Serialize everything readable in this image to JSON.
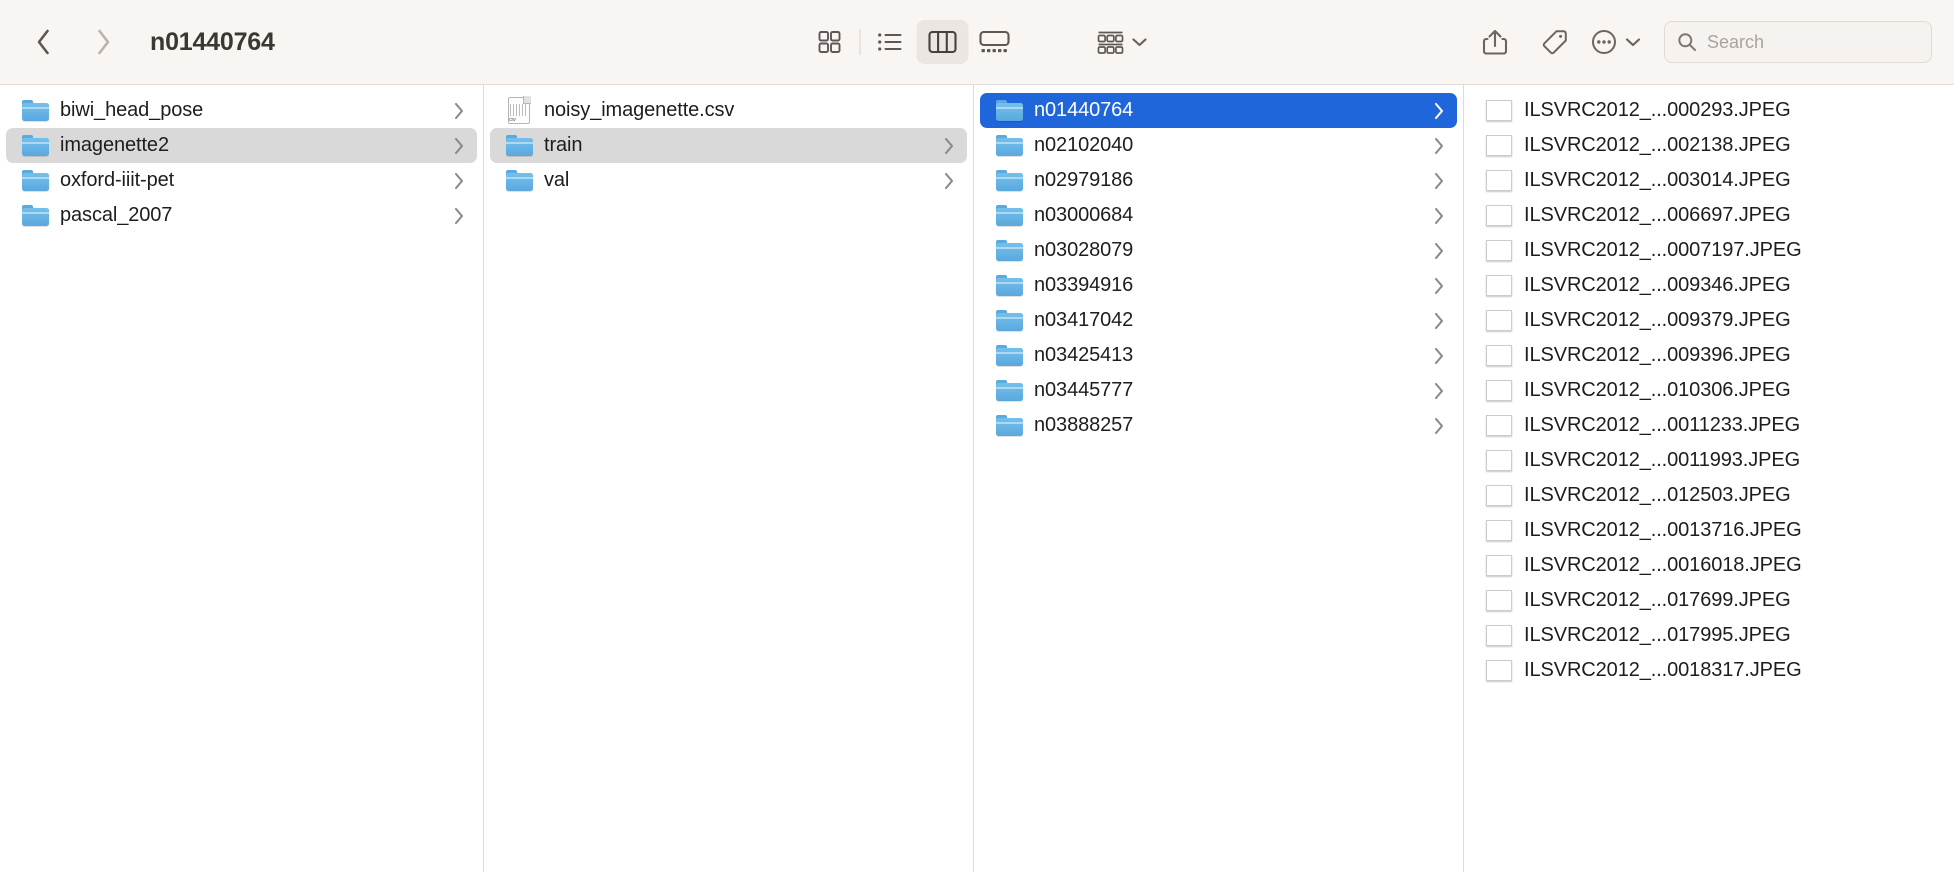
{
  "window": {
    "title": "n01440764"
  },
  "toolbar": {
    "back_label": "Back",
    "forward_label": "Forward",
    "view_icon_label": "Icon view",
    "view_list_label": "List view",
    "view_column_label": "Column view",
    "view_gallery_label": "Gallery view",
    "group_label": "Group items",
    "share_label": "Share",
    "tag_label": "Tags",
    "more_label": "More",
    "active_view": "column",
    "accent_color": "#1f66da",
    "toolbar_bg": "#f9f5f2"
  },
  "search": {
    "value": "",
    "placeholder": "Search"
  },
  "columns": [
    {
      "name": "column-1",
      "items": [
        {
          "label": "biwi_head_pose",
          "type": "folder",
          "selected": false,
          "disclosure": true
        },
        {
          "label": "imagenette2",
          "type": "folder",
          "selected": "gray",
          "disclosure": true
        },
        {
          "label": "oxford-iiit-pet",
          "type": "folder",
          "selected": false,
          "disclosure": true
        },
        {
          "label": "pascal_2007",
          "type": "folder",
          "selected": false,
          "disclosure": true
        }
      ]
    },
    {
      "name": "column-2",
      "items": [
        {
          "label": "noisy_imagenette.csv",
          "type": "csv",
          "selected": false,
          "disclosure": false
        },
        {
          "label": "train",
          "type": "folder",
          "selected": "gray",
          "disclosure": true
        },
        {
          "label": "val",
          "type": "folder",
          "selected": false,
          "disclosure": true
        }
      ]
    },
    {
      "name": "column-3",
      "items": [
        {
          "label": "n01440764",
          "type": "folder",
          "selected": "blue",
          "disclosure": true
        },
        {
          "label": "n02102040",
          "type": "folder",
          "selected": false,
          "disclosure": true
        },
        {
          "label": "n02979186",
          "type": "folder",
          "selected": false,
          "disclosure": true
        },
        {
          "label": "n03000684",
          "type": "folder",
          "selected": false,
          "disclosure": true
        },
        {
          "label": "n03028079",
          "type": "folder",
          "selected": false,
          "disclosure": true
        },
        {
          "label": "n03394916",
          "type": "folder",
          "selected": false,
          "disclosure": true
        },
        {
          "label": "n03417042",
          "type": "folder",
          "selected": false,
          "disclosure": true
        },
        {
          "label": "n03425413",
          "type": "folder",
          "selected": false,
          "disclosure": true
        },
        {
          "label": "n03445777",
          "type": "folder",
          "selected": false,
          "disclosure": true
        },
        {
          "label": "n03888257",
          "type": "folder",
          "selected": false,
          "disclosure": true
        }
      ]
    },
    {
      "name": "column-4",
      "items": [
        {
          "label": "ILSVRC2012_...000293.JPEG",
          "type": "image",
          "selected": false,
          "disclosure": false,
          "thumb": "#7d8a5c"
        },
        {
          "label": "ILSVRC2012_...002138.JPEG",
          "type": "image",
          "selected": false,
          "disclosure": false,
          "thumb": "#3c4a36"
        },
        {
          "label": "ILSVRC2012_...003014.JPEG",
          "type": "image",
          "selected": false,
          "disclosure": false,
          "thumb": "#8a4630"
        },
        {
          "label": "ILSVRC2012_...006697.JPEG",
          "type": "image",
          "selected": false,
          "disclosure": false,
          "thumb": "#59703f"
        },
        {
          "label": "ILSVRC2012_...0007197.JPEG",
          "type": "image",
          "selected": false,
          "disclosure": false,
          "thumb": "#6d7b39"
        },
        {
          "label": "ILSVRC2012_...009346.JPEG",
          "type": "image",
          "selected": false,
          "disclosure": false,
          "thumb": "#4a5340"
        },
        {
          "label": "ILSVRC2012_...009379.JPEG",
          "type": "image",
          "selected": false,
          "disclosure": false,
          "thumb": "#6b7b55"
        },
        {
          "label": "ILSVRC2012_...009396.JPEG",
          "type": "image",
          "selected": false,
          "disclosure": false,
          "thumb": "#9aa487"
        },
        {
          "label": "ILSVRC2012_...010306.JPEG",
          "type": "image",
          "selected": false,
          "disclosure": false,
          "thumb": "#8e8275"
        },
        {
          "label": "ILSVRC2012_...0011233.JPEG",
          "type": "image",
          "selected": false,
          "disclosure": false,
          "thumb": "#4f6040"
        },
        {
          "label": "ILSVRC2012_...0011993.JPEG",
          "type": "image",
          "selected": false,
          "disclosure": false,
          "thumb": "#7f8a5e"
        },
        {
          "label": "ILSVRC2012_...012503.JPEG",
          "type": "image",
          "selected": false,
          "disclosure": false,
          "thumb": "#566246"
        },
        {
          "label": "ILSVRC2012_...0013716.JPEG",
          "type": "image",
          "selected": false,
          "disclosure": false,
          "thumb": "#4d5c3e"
        },
        {
          "label": "ILSVRC2012_...0016018.JPEG",
          "type": "image",
          "selected": false,
          "disclosure": false,
          "thumb": "#2f3a33"
        },
        {
          "label": "ILSVRC2012_...017699.JPEG",
          "type": "image",
          "selected": false,
          "disclosure": false,
          "thumb": "#2c4a6e"
        },
        {
          "label": "ILSVRC2012_...017995.JPEG",
          "type": "image",
          "selected": false,
          "disclosure": false,
          "thumb": "#1c1a18"
        },
        {
          "label": "ILSVRC2012_...0018317.JPEG",
          "type": "image",
          "selected": false,
          "disclosure": false,
          "thumb": "#41573a"
        }
      ]
    }
  ]
}
